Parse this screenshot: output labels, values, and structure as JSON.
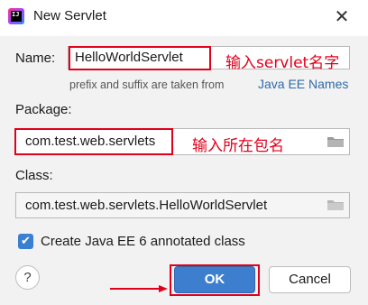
{
  "window": {
    "title": "New Servlet",
    "app_icon_text": "IJ",
    "close_glyph": "✕"
  },
  "form": {
    "name_label": "Name:",
    "name_value": "HelloWorldServlet",
    "hint_text": "prefix and suffix are taken from",
    "hint_link": "Java EE Names",
    "package_label": "Package:",
    "package_value": "com.test.web.servlets",
    "class_label": "Class:",
    "class_value": "com.test.web.servlets.HelloWorldServlet",
    "checkbox_label": "Create Java EE 6 annotated class",
    "checkbox_checked": true
  },
  "annotations": {
    "name_note": "输入servlet名字",
    "package_note": "输入所在包名"
  },
  "buttons": {
    "help": "?",
    "ok": "OK",
    "cancel": "Cancel"
  },
  "colors": {
    "accent": "#3d7fce",
    "annotation": "#e0001b",
    "link": "#2f6aa8"
  },
  "icons": {
    "folder": "folder-icon",
    "check": "checkmark-icon"
  }
}
